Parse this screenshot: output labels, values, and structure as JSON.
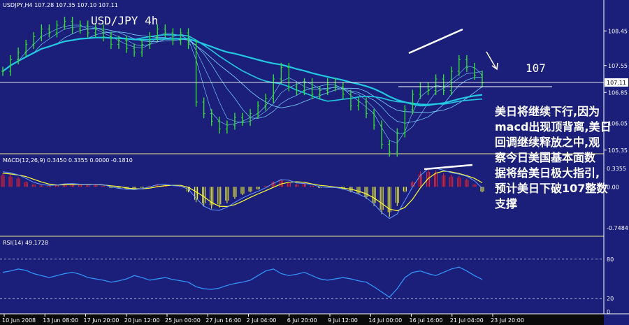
{
  "chart_data": [
    {
      "type": "line",
      "header": "USDJPY,H4  107.28 107.35 107.10 107.11",
      "overlay_title": "USD/JPY  4h",
      "ylim": [
        105.4,
        109.0
      ],
      "y_ticks": [
        "108.45",
        "107.55",
        "106.85",
        "106.05",
        "105.35"
      ],
      "current_price": "107.11",
      "target_label": "107",
      "annotation": "美日将继续下行,因为macd出现顶背离,美日回调继续释放之中,观察今日美国基本面数据将给美日极大指引,预计美日下破107整数支撑",
      "annotation_lines": [
        "美日将继续下行,因为",
        "macd出现顶背离,美日",
        "回调继续释放之中,观",
        "察今日美国基本面数",
        "据将给美日极大指引,",
        "预计美日下破107整数",
        "支撑"
      ],
      "x_labels": [
        "10 Jun 2008",
        "13 Jun 08:00",
        "17 Jun 20:00",
        "20 Jun 12:00",
        "25 Jun 00:00",
        "27 Jun 16:00",
        "2 Jul 04:00",
        "6 Jul 20:00",
        "9 Jul 12:00",
        "14 Jul 00:00",
        "16 Jul 16:00",
        "21 Jul 04:00",
        "23 Jul 20:00"
      ],
      "close": [
        107.4,
        107.7,
        107.9,
        108.1,
        108.3,
        108.5,
        108.4,
        108.6,
        108.7,
        108.5,
        108.6,
        108.4,
        108.5,
        108.3,
        108.1,
        108.2,
        108.0,
        107.9,
        108.1,
        108.3,
        108.5,
        108.4,
        108.2,
        108.4,
        108.1,
        106.6,
        106.3,
        106.1,
        105.9,
        106.0,
        106.2,
        106.1,
        106.3,
        106.5,
        106.7,
        107.2,
        107.5,
        107.0,
        106.9,
        107.1,
        106.8,
        106.9,
        107.1,
        107.0,
        106.8,
        106.5,
        106.6,
        106.3,
        106.0,
        105.5,
        105.3,
        105.8,
        106.4,
        106.8,
        107.0,
        106.9,
        107.2,
        106.9,
        107.4,
        107.7,
        107.5,
        107.3,
        107.1
      ],
      "colors": {
        "candles": "#33dd33",
        "ma_fast": "#7fd8ff",
        "ma_slow": "#22c8e0",
        "trend": "#ffffff"
      }
    },
    {
      "type": "bar",
      "header": "MACD(12,26,9) 0.3450 0.3355 0.0000 -0.1810",
      "ylim": [
        -0.8,
        0.4
      ],
      "y_ticks": [
        "0.3355",
        "0.00",
        "-0.7484"
      ],
      "values": [
        0.25,
        0.22,
        0.18,
        0.1,
        0.05,
        0.03,
        0.02,
        0.04,
        0.06,
        0.05,
        0.04,
        0.03,
        0.05,
        0.02,
        -0.02,
        -0.03,
        -0.05,
        -0.04,
        -0.02,
        0.02,
        0.05,
        0.04,
        0.0,
        0.02,
        -0.1,
        -0.28,
        -0.36,
        -0.4,
        -0.38,
        -0.3,
        -0.22,
        -0.15,
        -0.1,
        -0.05,
        0.02,
        0.1,
        0.14,
        0.08,
        0.05,
        0.06,
        0.02,
        -0.02,
        0.0,
        -0.02,
        -0.05,
        -0.1,
        -0.14,
        -0.22,
        -0.35,
        -0.5,
        -0.55,
        -0.35,
        -0.1,
        0.1,
        0.28,
        0.32,
        0.3,
        0.25,
        0.22,
        0.2,
        0.15,
        0.05,
        -0.1
      ],
      "colors": {
        "positive": "#ff2222",
        "negative": "#ffff33",
        "signal": "#ffff33",
        "macd": "#6699ff"
      }
    },
    {
      "type": "line",
      "header": "RSI(14) 49.1728",
      "ylim": [
        0,
        100
      ],
      "y_ticks": [
        "80",
        "20",
        "0"
      ],
      "values": [
        60,
        62,
        65,
        63,
        58,
        55,
        52,
        55,
        58,
        60,
        57,
        52,
        50,
        48,
        45,
        47,
        50,
        55,
        52,
        48,
        50,
        52,
        49,
        47,
        45,
        38,
        35,
        34,
        36,
        40,
        43,
        45,
        48,
        55,
        62,
        65,
        58,
        55,
        57,
        60,
        55,
        50,
        48,
        50,
        52,
        50,
        47,
        45,
        38,
        30,
        22,
        35,
        52,
        60,
        62,
        58,
        55,
        60,
        65,
        68,
        62,
        55,
        49
      ],
      "colors": {
        "line": "#3399ff",
        "levels": "#ffffff"
      }
    }
  ]
}
